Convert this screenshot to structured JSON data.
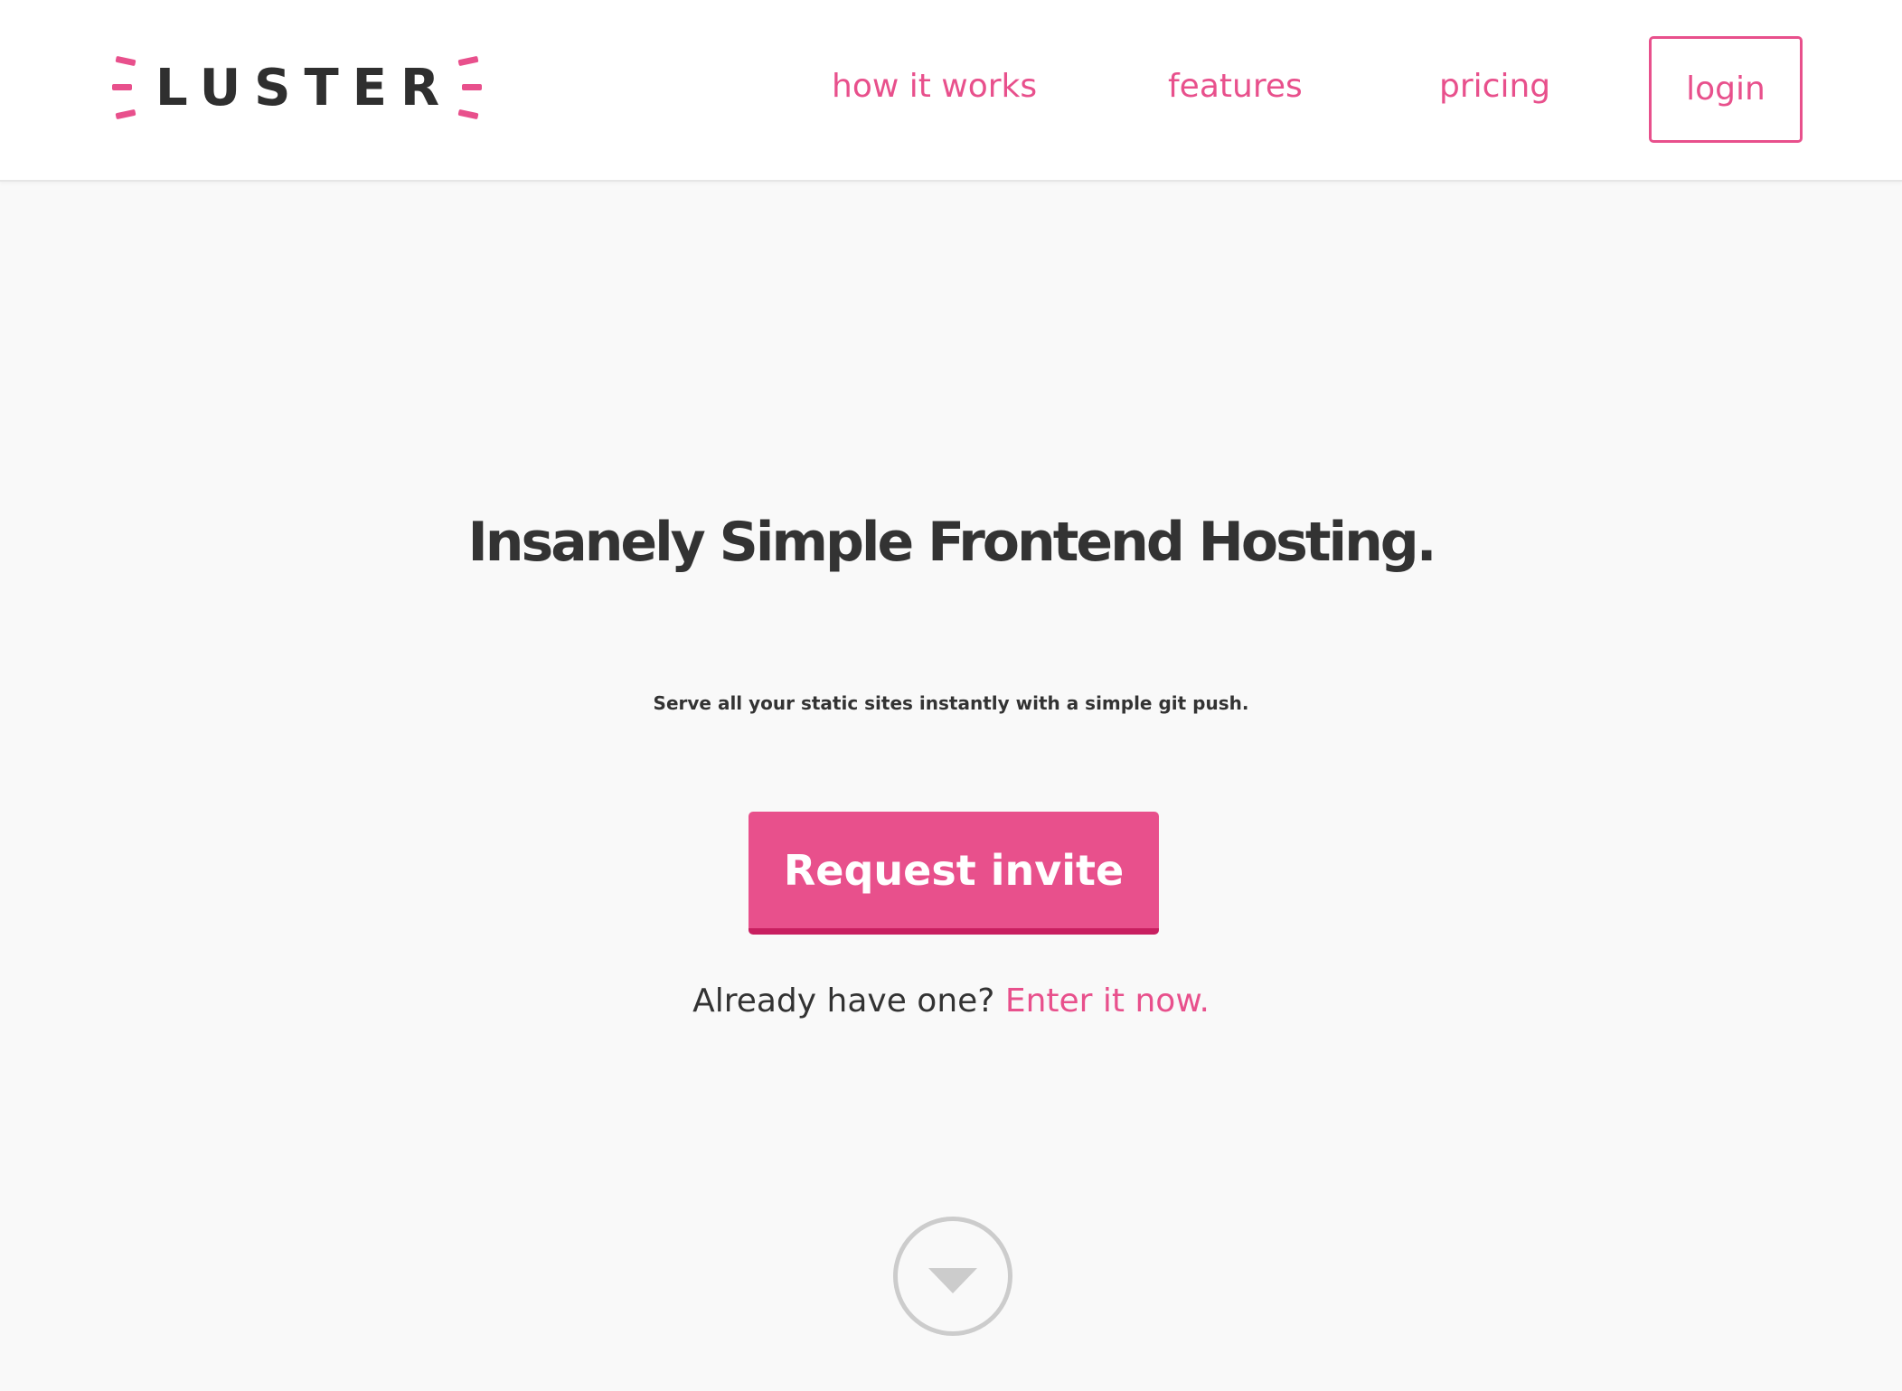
{
  "brand": {
    "name": "LUSTER",
    "accent_color": "#e8508c",
    "text_color": "#333333"
  },
  "nav": {
    "how_it_works": "how it works",
    "features": "features",
    "pricing": "pricing",
    "login": "login"
  },
  "hero": {
    "title": "Insanely Simple Frontend Hosting.",
    "subtitle": "Serve all your static sites instantly with a simple git push.",
    "cta_label": "Request invite",
    "already_text": "Already have one?",
    "enter_link": "Enter it now."
  },
  "icons": {
    "scroll": "chevron-down-circle-icon"
  }
}
